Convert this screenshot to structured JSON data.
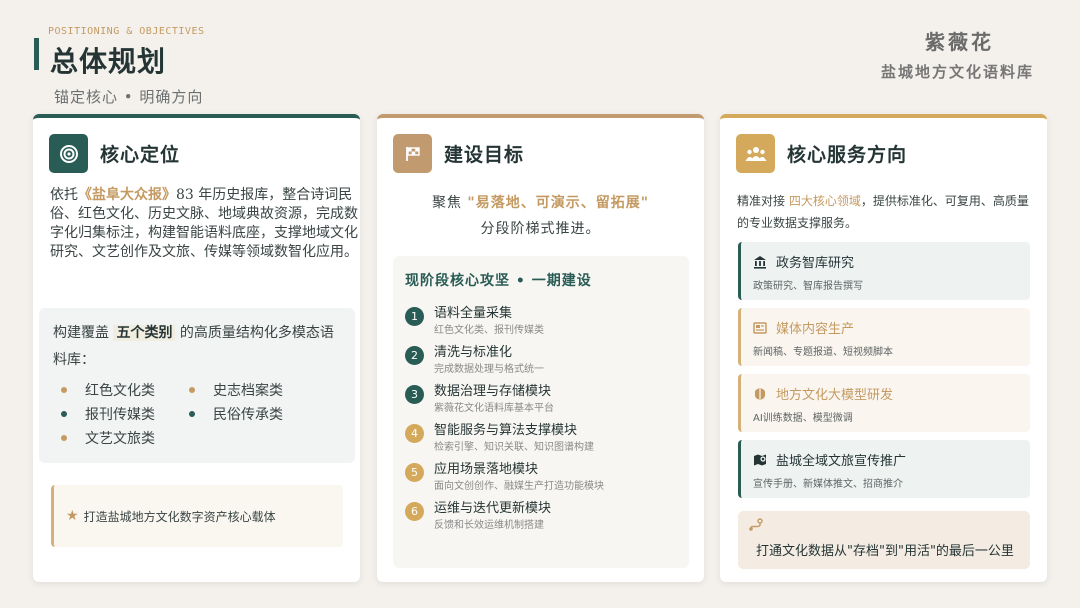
{
  "header": {
    "eyebrow": "POSITIONING & OBJECTIVES",
    "title": "总体规划",
    "subtitle": "锚定核心 • 明确方向",
    "brand_line1": "紫薇花",
    "brand_line2": "盐城地方文化语料库"
  },
  "card1": {
    "title": "核心定位",
    "icon": "target-icon",
    "intro_prefix": "依托",
    "intro_highlight": "《盐阜大众报》",
    "intro_rest": "83 年历史报库，整合诗词民俗、红色文化、历史文脉、地域典故资源，完成数字化归集标注，构建智能语料底座，支撑地域文化研究、文艺创作及文旅、传媒等领域数智化应用。",
    "box_prefix": "构建覆盖",
    "box_highlight": "五个类别",
    "box_rest": "的高质量结构化多模态语料库：",
    "categories": [
      {
        "label": "红色文化类",
        "color": "orange"
      },
      {
        "label": "史志档案类",
        "color": "orange"
      },
      {
        "label": "报刊传媒类",
        "color": "green"
      },
      {
        "label": "民俗传承类",
        "color": "green"
      },
      {
        "label": "文艺文旅类",
        "color": "orange"
      }
    ],
    "note": "打造盐城地方文化数字资产核心载体"
  },
  "card2": {
    "title": "建设目标",
    "icon": "flag-icon",
    "lead_prefix": "聚焦",
    "lead_highlight": "\"易落地、可演示、留拓展\"",
    "lead_line2": "分段阶梯式推进。",
    "box_title": "现阶段核心攻坚 • 一期建设",
    "steps": [
      {
        "num": "1",
        "title": "语料全量采集",
        "sub": "红色文化类、报刊传媒类"
      },
      {
        "num": "2",
        "title": "清洗与标准化",
        "sub": "完成数据处理与格式统一"
      },
      {
        "num": "3",
        "title": "数据治理与存储模块",
        "sub": "紫薇花文化语料库基本平台"
      },
      {
        "num": "4",
        "title": "智能服务与算法支撑模块",
        "sub": "检索引擎、知识关联、知识图谱构建"
      },
      {
        "num": "5",
        "title": "应用场景落地模块",
        "sub": "面向文创创作、融媒生产打造功能模块"
      },
      {
        "num": "6",
        "title": "运维与迭代更新模块",
        "sub": "反馈和长效运维机制搭建"
      }
    ]
  },
  "card3": {
    "title": "核心服务方向",
    "icon": "users-icon",
    "intro_prefix": "精准对接",
    "intro_highlight": "四大核心领域",
    "intro_rest": "，提供标准化、可复用、高质量的专业数据支撑服务。",
    "services": [
      {
        "title": "政务智库研究",
        "sub": "政策研究、智库报告撰写",
        "icon": "bank-icon"
      },
      {
        "title": "媒体内容生产",
        "sub": "新闻稿、专题报道、短视频脚本",
        "icon": "newspaper-icon"
      },
      {
        "title": "地方文化大模型研发",
        "sub": "AI训练数据、模型微调",
        "icon": "brain-icon"
      },
      {
        "title": "盐城全域文旅宣传推广",
        "sub": "宣传手册、新媒体推文、招商推介",
        "icon": "map-pin-icon"
      }
    ],
    "footer": "打通文化数据从\"存档\"到\"用活\"的最后一公里",
    "footer_icon": "route-icon"
  },
  "colors": {
    "teal": "#2a5c56",
    "tan": "#c29a70",
    "gold": "#d4a95c",
    "accent": "#c49a62"
  }
}
